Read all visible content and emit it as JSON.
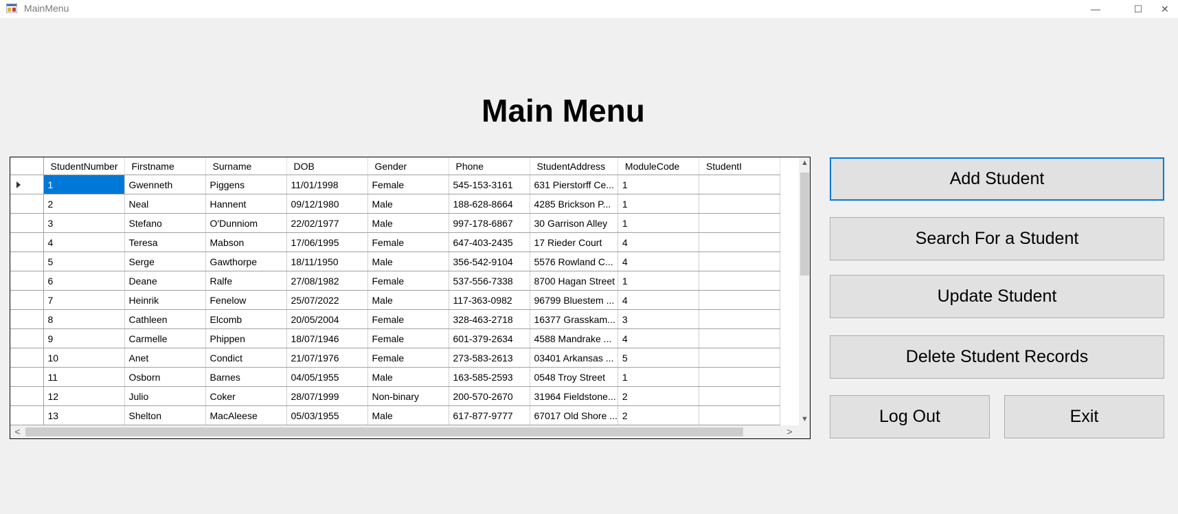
{
  "window": {
    "title": "MainMenu",
    "minimize_glyph": "—",
    "maximize_glyph": "☐",
    "close_glyph": "✕",
    "icon": "app-form-icon"
  },
  "heading": "Main Menu",
  "grid": {
    "columns": [
      "StudentNumber",
      "Firstname",
      "Surname",
      "DOB",
      "Gender",
      "Phone",
      "StudentAddress",
      "ModuleCode",
      "StudentI"
    ],
    "rows": [
      [
        "1",
        "Gwenneth",
        "Piggens",
        "11/01/1998",
        "Female",
        "545-153-3161",
        "631 Pierstorff Ce...",
        "1",
        ""
      ],
      [
        "2",
        "Neal",
        "Hannent",
        "09/12/1980",
        "Male",
        "188-628-8664",
        "4285 Brickson P...",
        "1",
        ""
      ],
      [
        "3",
        "Stefano",
        "O'Dunniom",
        "22/02/1977",
        "Male",
        "997-178-6867",
        "30 Garrison Alley",
        "1",
        ""
      ],
      [
        "4",
        "Teresa",
        "Mabson",
        "17/06/1995",
        "Female",
        "647-403-2435",
        "17 Rieder Court",
        "4",
        ""
      ],
      [
        "5",
        "Serge",
        "Gawthorpe",
        "18/11/1950",
        "Male",
        "356-542-9104",
        "5576 Rowland C...",
        "4",
        ""
      ],
      [
        "6",
        "Deane",
        "Ralfe",
        "27/08/1982",
        "Female",
        "537-556-7338",
        "8700 Hagan Street",
        "1",
        ""
      ],
      [
        "7",
        "Heinrik",
        "Fenelow",
        "25/07/2022",
        "Male",
        "117-363-0982",
        "96799 Bluestem ...",
        "4",
        ""
      ],
      [
        "8",
        "Cathleen",
        "Elcomb",
        "20/05/2004",
        "Female",
        "328-463-2718",
        "16377 Grasskam...",
        "3",
        ""
      ],
      [
        "9",
        "Carmelle",
        "Phippen",
        "18/07/1946",
        "Female",
        "601-379-2634",
        "4588 Mandrake ...",
        "4",
        ""
      ],
      [
        "10",
        "Anet",
        "Condict",
        "21/07/1976",
        "Female",
        "273-583-2613",
        "03401 Arkansas ...",
        "5",
        ""
      ],
      [
        "11",
        "Osborn",
        "Barnes",
        "04/05/1955",
        "Male",
        "163-585-2593",
        "0548 Troy Street",
        "1",
        ""
      ],
      [
        "12",
        "Julio",
        "Coker",
        "28/07/1999",
        "Non-binary",
        "200-570-2670",
        "31964 Fieldstone...",
        "2",
        ""
      ],
      [
        "13",
        "Shelton",
        "MacAleese",
        "05/03/1955",
        "Male",
        "617-877-9777",
        "67017 Old Shore ...",
        "2",
        ""
      ]
    ],
    "selected_row": 0,
    "scroll_glyphs": {
      "up": "▲",
      "down": "▼",
      "left": "<",
      "right": ">"
    }
  },
  "buttons": {
    "add": "Add Student",
    "search": "Search For a Student",
    "update": "Update Student",
    "delete": "Delete Student Records",
    "logout": "Log Out",
    "exit": "Exit"
  },
  "colors": {
    "selection": "#0078d7",
    "focus_border": "#0078d7",
    "button_bg": "#e1e1e1",
    "form_bg": "#f0f0f0"
  }
}
